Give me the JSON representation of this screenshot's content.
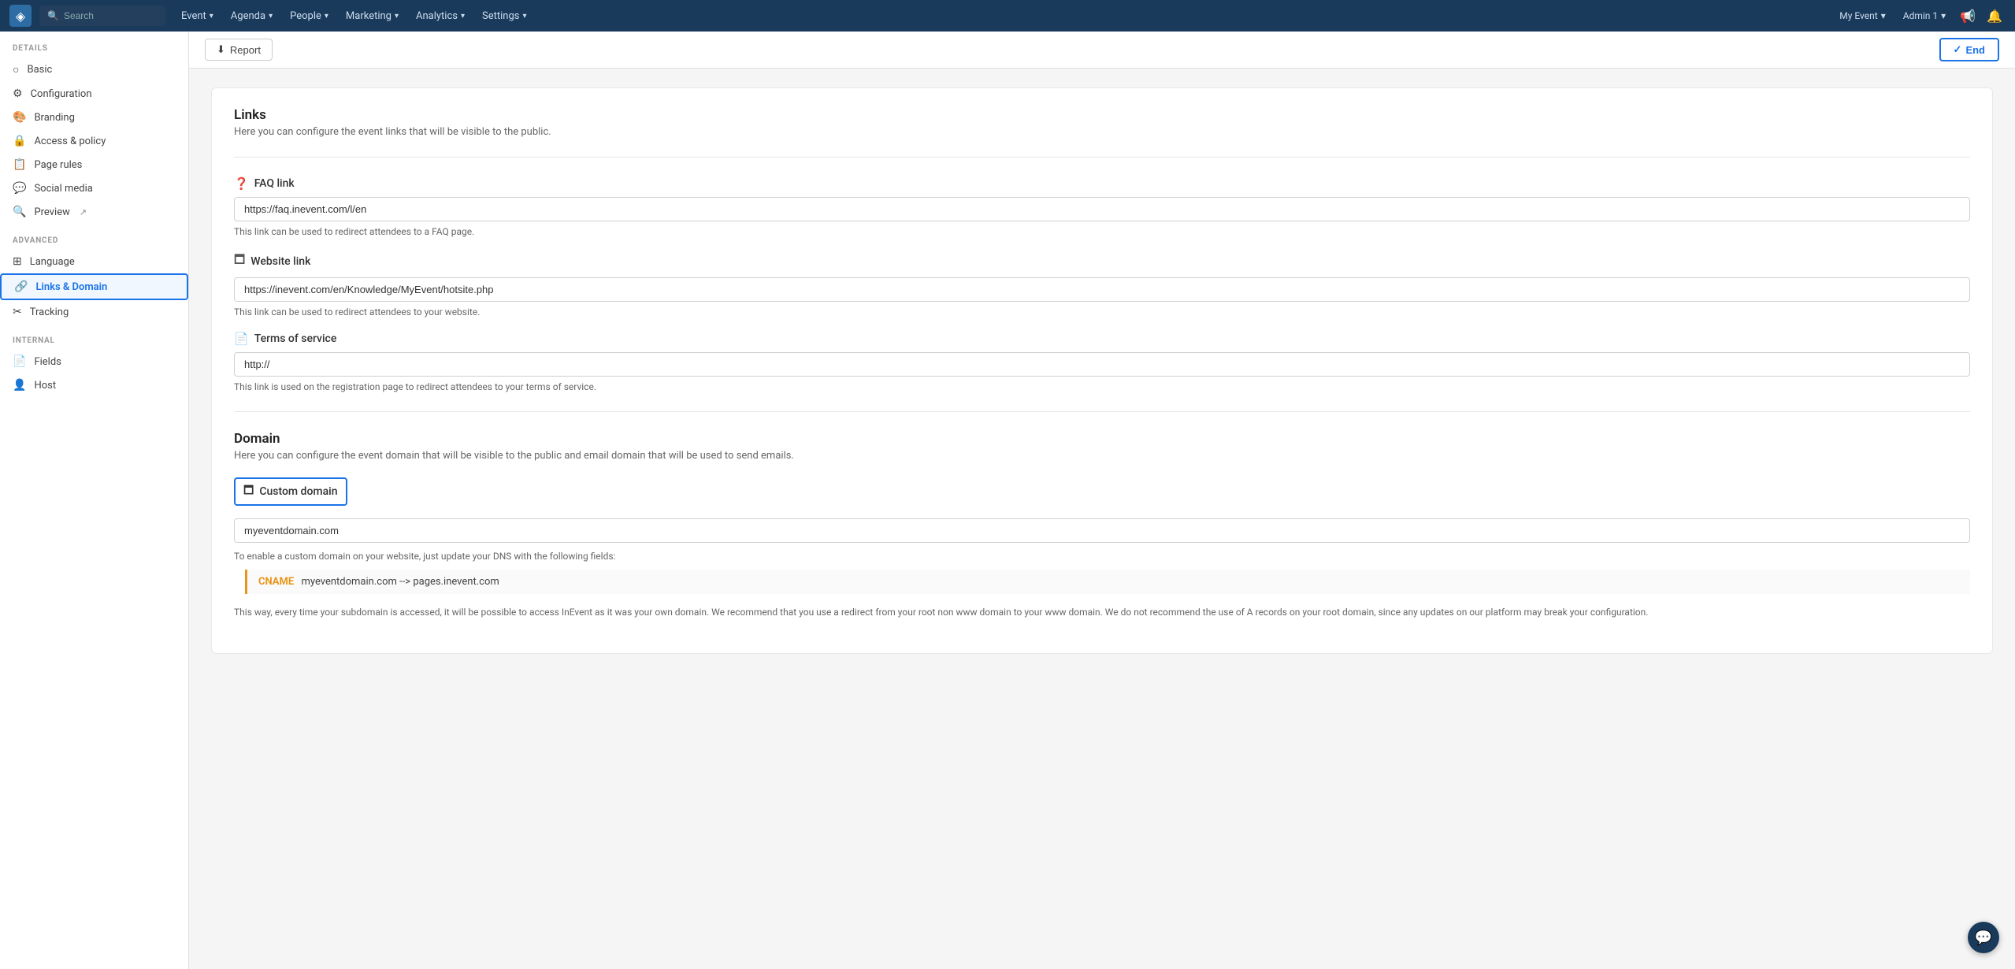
{
  "topnav": {
    "logo_icon": "◈",
    "search_placeholder": "Search",
    "items": [
      {
        "label": "Event",
        "has_chevron": true
      },
      {
        "label": "Agenda",
        "has_chevron": true
      },
      {
        "label": "People",
        "has_chevron": true
      },
      {
        "label": "Marketing",
        "has_chevron": true
      },
      {
        "label": "Analytics",
        "has_chevron": true
      },
      {
        "label": "Settings",
        "has_chevron": true
      }
    ],
    "my_event_label": "My Event",
    "admin_label": "Admin 1",
    "notification_icon": "🔔",
    "megaphone_icon": "📢"
  },
  "sidebar": {
    "details_label": "DETAILS",
    "details_items": [
      {
        "id": "basic",
        "label": "Basic",
        "icon": "○"
      },
      {
        "id": "configuration",
        "label": "Configuration",
        "icon": "⚙"
      },
      {
        "id": "branding",
        "label": "Branding",
        "icon": "🎨"
      },
      {
        "id": "access-policy",
        "label": "Access & policy",
        "icon": "🔒"
      },
      {
        "id": "page-rules",
        "label": "Page rules",
        "icon": "📋"
      },
      {
        "id": "social-media",
        "label": "Social media",
        "icon": "💬"
      },
      {
        "id": "preview",
        "label": "Preview",
        "icon": "🔍"
      }
    ],
    "advanced_label": "ADVANCED",
    "advanced_items": [
      {
        "id": "language",
        "label": "Language",
        "icon": "⊞"
      },
      {
        "id": "links-domain",
        "label": "Links & Domain",
        "icon": "🔗",
        "active": true
      },
      {
        "id": "tracking",
        "label": "Tracking",
        "icon": "✂"
      }
    ],
    "internal_label": "INTERNAL",
    "internal_items": [
      {
        "id": "fields",
        "label": "Fields",
        "icon": "📄"
      },
      {
        "id": "host",
        "label": "Host",
        "icon": "👤"
      }
    ]
  },
  "toolbar": {
    "report_label": "Report",
    "end_label": "End"
  },
  "main": {
    "links_section": {
      "title": "Links",
      "description": "Here you can configure the event links that will be visible to the public.",
      "faq_link": {
        "label": "FAQ link",
        "value": "https://faq.inevent.com/l/en",
        "hint": "This link can be used to redirect attendees to a FAQ page."
      },
      "website_link": {
        "label": "Website link",
        "value": "https://inevent.com/en/Knowledge/MyEvent/hotsite.php",
        "hint": "This link can be used to redirect attendees to your website."
      },
      "terms_link": {
        "label": "Terms of service",
        "value": "http://",
        "hint": "This link is used on the registration page to redirect attendees to your terms of service."
      }
    },
    "domain_section": {
      "title": "Domain",
      "description": "Here you can configure the event domain that will be visible to the public and email domain that will be used to send emails.",
      "custom_domain": {
        "label": "Custom domain",
        "value": "myeventdomain.com",
        "dns_hint": "To enable a custom domain on your website, just update your DNS with the following fields:",
        "cname_label": "CNAME",
        "cname_value": "myeventdomain.com --> pages.inevent.com",
        "bottom_desc": "This way, every time your subdomain is accessed, it will be possible to access InEvent as it was your own domain. We recommend that you use a redirect from your root non www domain to your www domain. We do not recommend the use of A records on your root domain, since any updates on our platform may break your configuration."
      }
    }
  }
}
